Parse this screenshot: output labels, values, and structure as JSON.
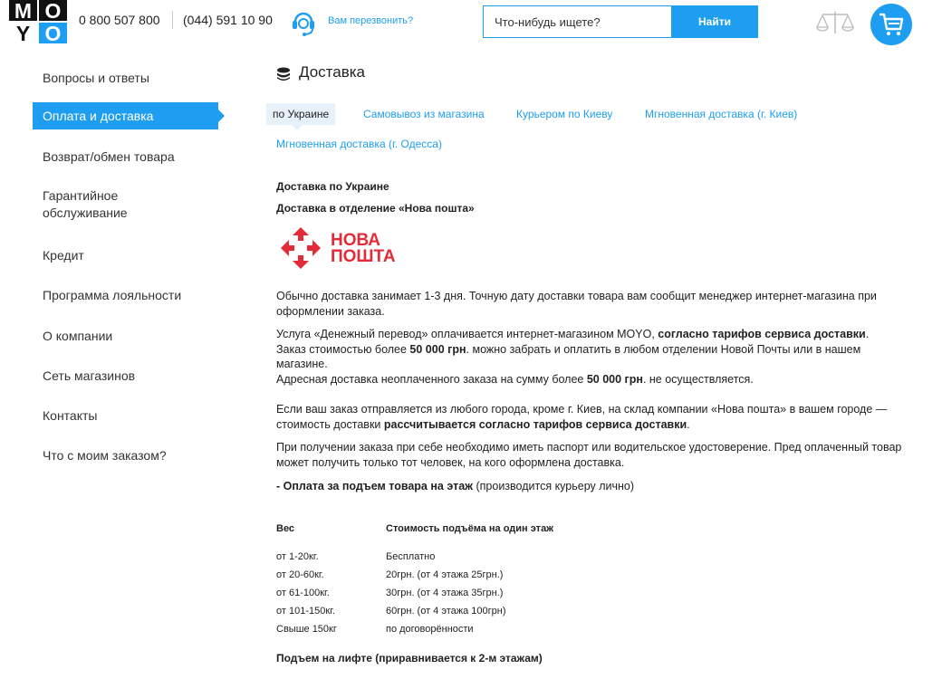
{
  "header": {
    "logo": {
      "letters": [
        "M",
        "O",
        "Y",
        "O"
      ]
    },
    "phone_1": "0 800 507 800",
    "phone_2": "(044) 591 10 90",
    "callback_label": "Вам перезвонить?",
    "search": {
      "placeholder": "Что-нибудь ищете?",
      "button_label": "Найти"
    },
    "accent_color": "#1e9ef0"
  },
  "sidebar": {
    "items": [
      {
        "label": "Вопросы и ответы"
      },
      {
        "label": "Оплата и доставка",
        "active": true
      },
      {
        "label": "Возврат/обмен товара"
      },
      {
        "label": "Гарантийное обслуживание"
      },
      {
        "label": "Кредит"
      },
      {
        "label": "Программа лояльности"
      },
      {
        "label": "О компании"
      },
      {
        "label": "Сеть магазинов"
      },
      {
        "label": "Контакты"
      },
      {
        "label": "Что с моим заказом?"
      }
    ]
  },
  "main": {
    "title": "Доставка",
    "tabs": [
      {
        "label": "по Украине",
        "active": true
      },
      {
        "label": "Самовывоз из магазина"
      },
      {
        "label": "Курьером по Киеву"
      },
      {
        "label": "Мгновенная доставка (г. Киев)"
      },
      {
        "label": "Мгновенная доставка (г. Одесса)"
      }
    ],
    "heading_1": "Доставка по Украине",
    "heading_2": "Доставка в отделение «Нова пошта»",
    "np_logo": {
      "line_1": "НОВА",
      "line_2": "ПОШТА",
      "color": "#e52b38"
    },
    "p1": "Обычно доставка занимает 1-3 дня. Точную дату доставки товара вам сообщит менеджер интернет-магазина при оформлении заказа.",
    "p2": {
      "a": "Услуга «Денежный перевод» оплачивается интернет-магазином MOYO, ",
      "b": "согласно тарифов сервиса доставки",
      "c": ".",
      "d": "Заказ стоимостью более ",
      "e": "50 000 грн",
      "f": ". можно забрать и оплатить в любом отделении Новой Почты или в нашем магазине.",
      "g": "Адресная доставка неоплаченного заказа на сумму более ",
      "h": "50 000 грн",
      "i": ". не осуществляется."
    },
    "p3": {
      "a": "Если ваш заказ отправляется из любого города, кроме г. Киев, на склад компании «Нова пошта» в вашем городе — стоимость доставки ",
      "b": "рассчитывается согласно тарифов сервиса доставки",
      "c": "."
    },
    "p4": "При получении заказа при себе необходимо иметь паспорт или водительское удостоверение. Пред оплаченный товар может получить только тот человек, на кого оформлена доставка.",
    "p5": {
      "a": "- Оплата за подъем товара на этаж",
      "b": " (производится курьеру лично)"
    },
    "table": {
      "headers": [
        "Вес",
        "Стоимость подъёма на один этаж"
      ],
      "rows": [
        [
          "от 1-20кг.",
          "Бесплатно"
        ],
        [
          "от 20-60кг.",
          "20грн. (от 4 этажа 25грн.)"
        ],
        [
          "от 61-100кг.",
          "30грн. (от 4 этажа 35грн.)"
        ],
        [
          "от 101-150кг.",
          "60грн. (от 4 этажа 100грн)"
        ],
        [
          "Свыше 150кг",
          "по договорённости"
        ]
      ]
    },
    "footer_note": "Подъем на лифте (приравнивается к 2-м этажам)"
  }
}
